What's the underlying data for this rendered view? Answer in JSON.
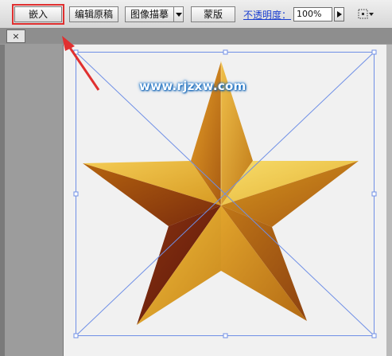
{
  "toolbar": {
    "embed_label": "嵌入",
    "edit_original_label": "编辑原稿",
    "image_trace_label": "图像描摹",
    "mask_label": "蒙版",
    "opacity_label": "不透明度：",
    "opacity_value": "100%"
  },
  "tab": {
    "close_label": "×"
  },
  "canvas": {
    "watermark_text": "www.rjzxw.com"
  },
  "colors": {
    "highlight": "#e03030",
    "selection": "#6f8fe6",
    "opacity_link": "#1b3fd0"
  }
}
